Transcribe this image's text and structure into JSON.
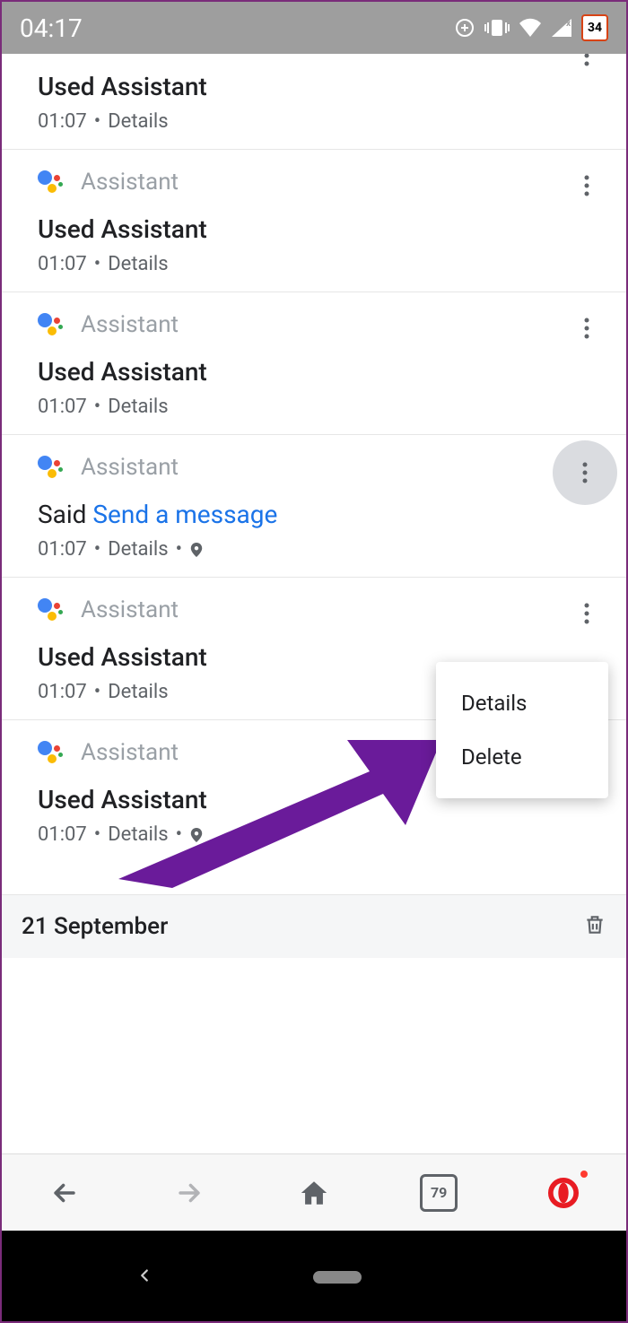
{
  "statusbar": {
    "time": "04:17",
    "calendar_day": "34"
  },
  "app_label": "Assistant",
  "items": [
    {
      "title": "Used Assistant",
      "time": "01:07",
      "details": "Details",
      "has_location": false,
      "is_said": false,
      "menu_open": false
    },
    {
      "title": "Used Assistant",
      "time": "01:07",
      "details": "Details",
      "has_location": false,
      "is_said": false,
      "menu_open": false
    },
    {
      "title": "Used Assistant",
      "time": "01:07",
      "details": "Details",
      "has_location": false,
      "is_said": false,
      "menu_open": false
    },
    {
      "said_prefix": "Said ",
      "said_text": "Send a message",
      "time": "01:07",
      "details": "Details",
      "has_location": true,
      "is_said": true,
      "menu_open": true
    },
    {
      "title": "Used Assistant",
      "time": "01:07",
      "details": "Details",
      "has_location": false,
      "is_said": false,
      "menu_open": false
    },
    {
      "title": "Used Assistant",
      "time": "01:07",
      "details": "Details",
      "has_location": true,
      "is_said": false,
      "menu_open": false
    }
  ],
  "date_section": {
    "label": "21 September"
  },
  "popup": {
    "details": "Details",
    "delete": "Delete"
  },
  "browser_tabs": "79"
}
